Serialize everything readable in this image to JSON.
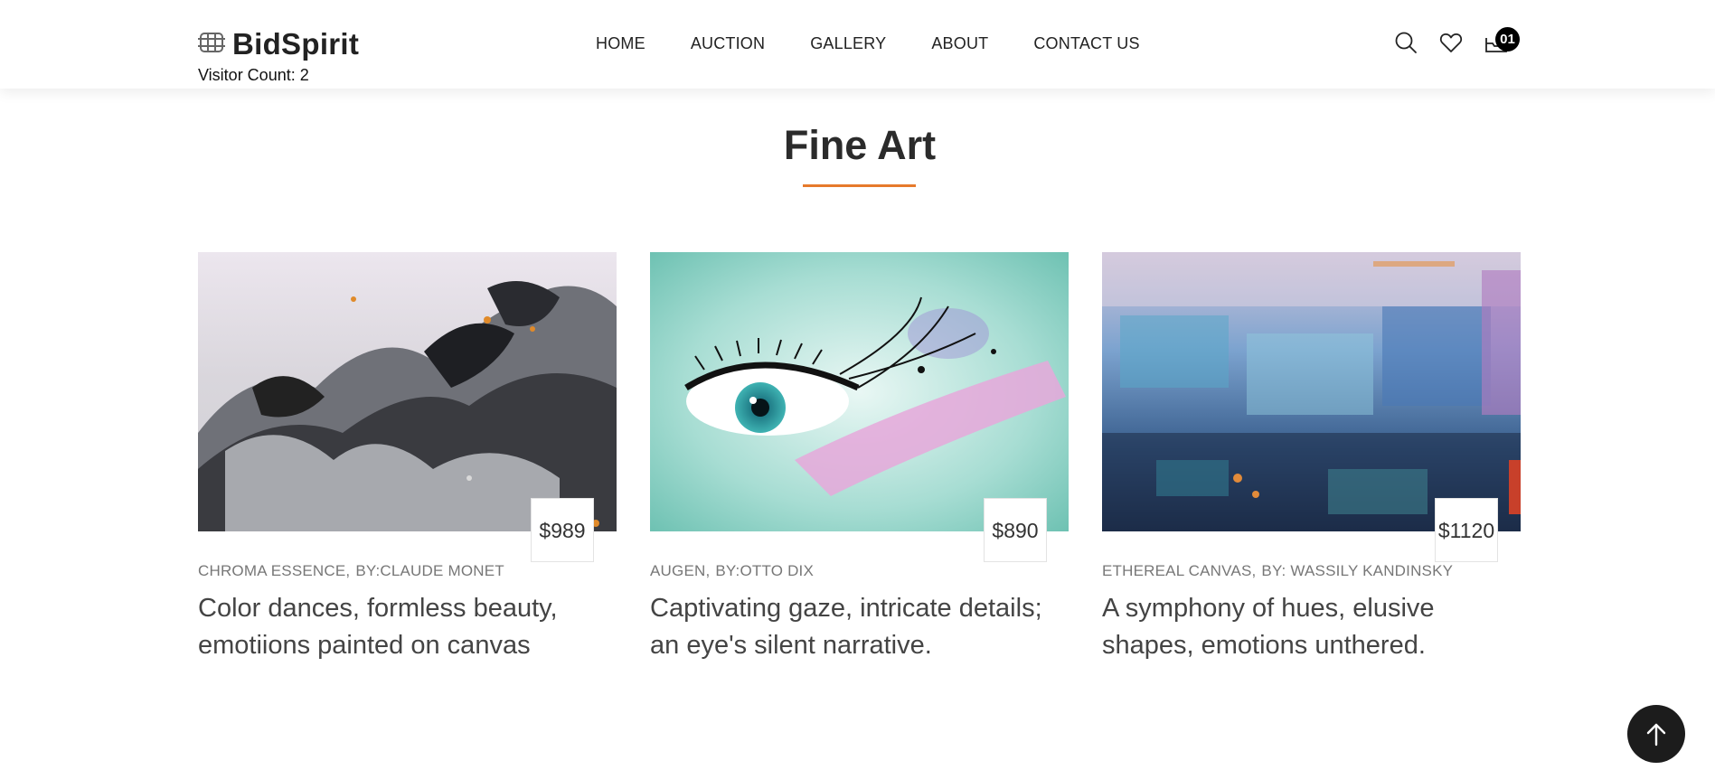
{
  "header": {
    "brand": "BidSpirit",
    "visitor_count": "Visitor Count: 2",
    "nav": [
      "HOME",
      "AUCTION",
      "GALLERY",
      "ABOUT",
      "CONTACT US"
    ],
    "cart_count": "01",
    "icons": [
      "logo-icon",
      "search-icon",
      "heart-icon",
      "cart-icon"
    ]
  },
  "section": {
    "title": "Fine Art",
    "accent_color": "#e67a2c"
  },
  "cards": [
    {
      "price": "$989",
      "title": "CHROMA ESSENCE,",
      "artist": "BY:CLAUDE MONET",
      "description": "Color dances, formless beauty, emotiions painted on canvas"
    },
    {
      "price": "$890",
      "title": "AUGEN,",
      "artist": "BY:OTTO DIX",
      "description": "Captivating gaze, intricate details; an eye's silent narrative."
    },
    {
      "price": "$1120",
      "title": "ETHEREAL CANVAS,",
      "artist": "BY: WASSILY KANDINSKY",
      "description": "A symphony of hues, elusive shapes, emotions unthered."
    }
  ],
  "scroll_top_icon": "arrow-up-icon"
}
